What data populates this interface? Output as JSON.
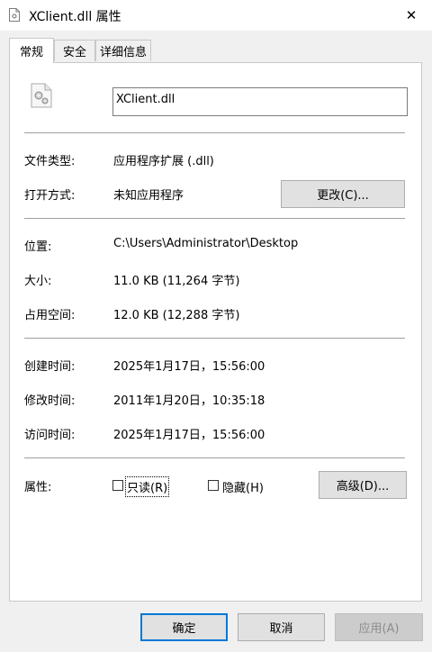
{
  "window": {
    "title": "XClient.dll 属性",
    "close_label": "✕"
  },
  "tabs": [
    {
      "label": "常规",
      "active": true
    },
    {
      "label": "安全",
      "active": false
    },
    {
      "label": "详细信息",
      "active": false
    }
  ],
  "general": {
    "file_icon": "dll-gear-file-icon",
    "file_name": "XClient.dll",
    "file_type_label": "文件类型:",
    "file_type_value": "应用程序扩展 (.dll)",
    "opens_with_label": "打开方式:",
    "opens_with_value": "未知应用程序",
    "change_button": "更改(C)...",
    "location_label": "位置:",
    "location_value": "C:\\Users\\Administrator\\Desktop",
    "size_label": "大小:",
    "size_value": "11.0 KB (11,264 字节)",
    "size_on_disk_label": "占用空间:",
    "size_on_disk_value": "12.0 KB (12,288 字节)",
    "created_label": "创建时间:",
    "created_value": "2025年1月17日，15:56:00",
    "modified_label": "修改时间:",
    "modified_value": "2011年1月20日，10:35:18",
    "accessed_label": "访问时间:",
    "accessed_value": "2025年1月17日，15:56:00",
    "attributes_label": "属性:",
    "readonly_label": "只读(R)",
    "hidden_label": "隐藏(H)",
    "advanced_button": "高级(D)..."
  },
  "footer": {
    "ok": "确定",
    "cancel": "取消",
    "apply": "应用(A)"
  },
  "colors": {
    "accent": "#0078d7",
    "window_bg": "#f0f0f0",
    "panel_bg": "#ffffff"
  }
}
